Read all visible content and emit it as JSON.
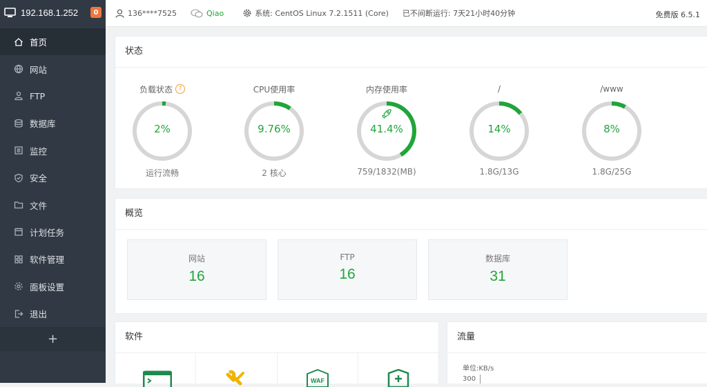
{
  "sidebar": {
    "host": "192.168.1.252",
    "badge": "0",
    "items": [
      {
        "label": "首页",
        "icon": "home-icon"
      },
      {
        "label": "网站",
        "icon": "globe-icon"
      },
      {
        "label": "FTP",
        "icon": "ftp-icon"
      },
      {
        "label": "数据库",
        "icon": "database-icon"
      },
      {
        "label": "监控",
        "icon": "monitor-icon"
      },
      {
        "label": "安全",
        "icon": "shield-icon"
      },
      {
        "label": "文件",
        "icon": "folder-icon"
      },
      {
        "label": "计划任务",
        "icon": "calendar-icon"
      },
      {
        "label": "软件管理",
        "icon": "apps-icon"
      },
      {
        "label": "面板设置",
        "icon": "gear-icon"
      },
      {
        "label": "退出",
        "icon": "logout-icon"
      }
    ],
    "add_label": "+"
  },
  "topbar": {
    "user": "136****7525",
    "wechat": "Qiao",
    "system": "系统:  CentOS Linux 7.2.1511 (Core)",
    "uptime": "已不间断运行: 7天21小时40分钟",
    "version": "免费版 6.5.1"
  },
  "status": {
    "title": "状态",
    "gauges": [
      {
        "label": "负载状态",
        "value": "2%",
        "percent": 2,
        "sub": "运行流畅",
        "help": "?"
      },
      {
        "label": "CPU使用率",
        "value": "9.76%",
        "percent": 9.76,
        "sub": "2 核心"
      },
      {
        "label": "内存使用率",
        "value": "41.4%",
        "percent": 41.4,
        "sub": "759/1832(MB)"
      },
      {
        "label": "/",
        "value": "14%",
        "percent": 14,
        "sub": "1.8G/13G"
      },
      {
        "label": "/www",
        "value": "8%",
        "percent": 8,
        "sub": "1.8G/25G"
      }
    ]
  },
  "overview": {
    "title": "概览",
    "items": [
      {
        "label": "网站",
        "value": "16"
      },
      {
        "label": "FTP",
        "value": "16"
      },
      {
        "label": "数据库",
        "value": "31"
      }
    ]
  },
  "software": {
    "title": "软件",
    "waf_label": "WAF"
  },
  "traffic": {
    "title": "流量",
    "unit": "单位:KB/s",
    "tick": "300"
  },
  "colors": {
    "accent": "#20a53a",
    "sidebar": "#313a44",
    "badge": "#f0763e"
  }
}
